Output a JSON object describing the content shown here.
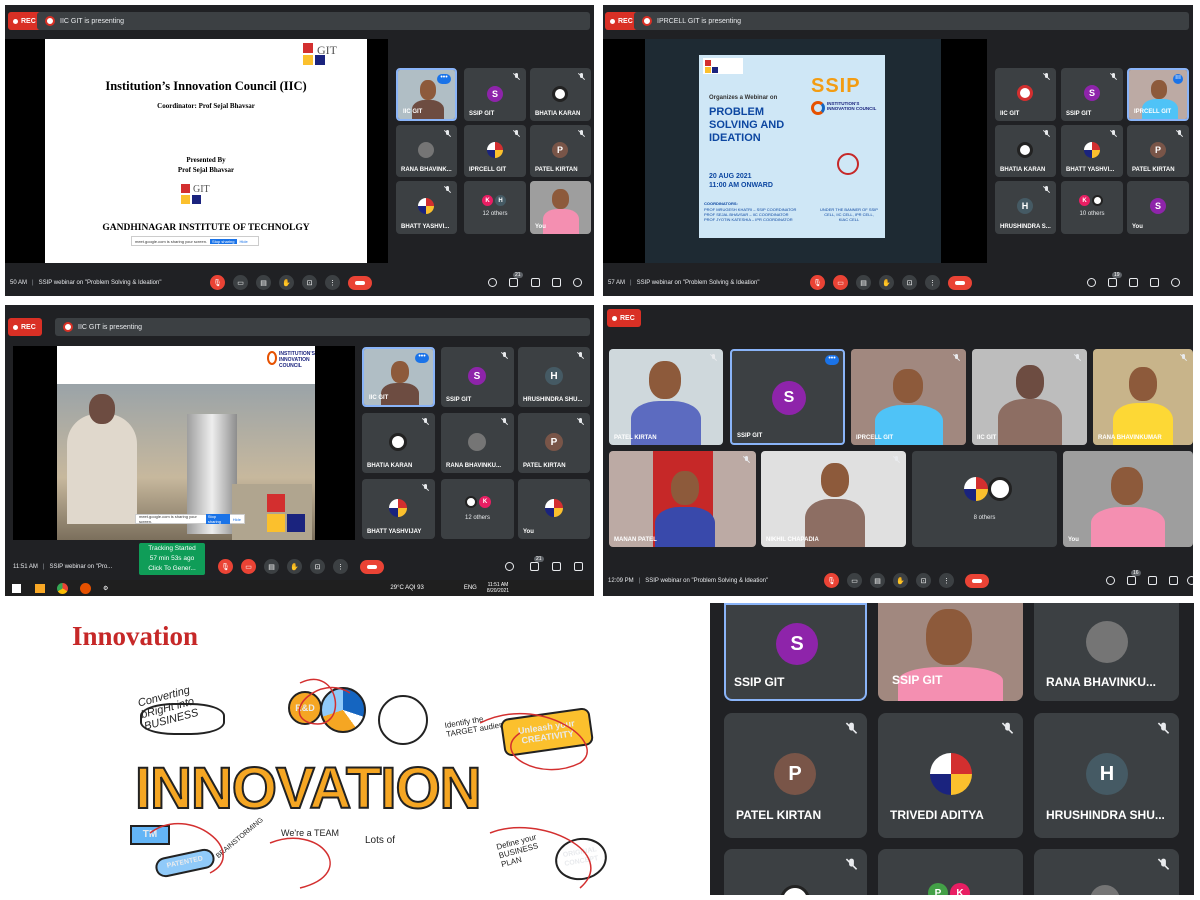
{
  "panel1": {
    "rec": "REC",
    "presenting": "IIC GIT is presenting",
    "slide": {
      "title": "Institution’s Innovation Council (IIC)",
      "coordinator": "Coordinator: Prof Sejal Bhavsar",
      "presented_by": "Presented By",
      "presenter": "Prof Sejal Bhavsar",
      "institute": "GANDHINAGAR INSTITUTE OF TECHNOLGY",
      "share_notice": "meet.google.com is sharing your screen.",
      "stop_sharing": "Stop sharing",
      "hide": "Hide"
    },
    "tiles": [
      {
        "name": "IIC GIT"
      },
      {
        "name": "SSIP GIT",
        "initial": "S",
        "color": "#8e24aa"
      },
      {
        "name": "BHATIA KARAN"
      },
      {
        "name": "RANA BHAVINK..."
      },
      {
        "name": "IPRCELL GIT"
      },
      {
        "name": "PATEL KIRTAN",
        "initial": "P",
        "color": "#795548"
      },
      {
        "name": "BHATT YASHVI..."
      },
      {
        "name": "12 others",
        "chips": [
          "K",
          "H"
        ]
      },
      {
        "name": "You"
      }
    ],
    "bar": {
      "time": "50 AM",
      "title": "SSIP webinar on \"Problem Solving & Ideation\"",
      "people": "21"
    }
  },
  "panel2": {
    "rec": "REC",
    "presenting": "IPRCELL GIT is presenting",
    "poster": {
      "brand": "SSIP",
      "org": "INSTITUTION'S INNOVATION COUNCIL",
      "intro": "Organizes a Webinar on",
      "headline": "PROBLEM SOLVING AND IDEATION",
      "date": "20 AUG 2021",
      "time": "11:00 AM ONWARD",
      "coord_head": "COORDINATORS:",
      "coords": [
        "PROF MRUGESH KHATRI – SSIP COORDINATOR",
        "PROF SEJAL BHAVSAR – IIC COORDINATOR",
        "PROF JYOTIN KATESHIA – IPR COORDINATOR"
      ],
      "banner": "UNDER THE BANNER OF SSIP CELL, IIC CELL, IPR CELL, KIAC CELL"
    },
    "tiles": [
      {
        "name": "IIC GIT"
      },
      {
        "name": "SSIP GIT",
        "initial": "S",
        "color": "#8e24aa"
      },
      {
        "name": "IPRCELL GIT"
      },
      {
        "name": "BHATIA KARAN"
      },
      {
        "name": "BHATT YASHVI..."
      },
      {
        "name": "PATEL KIRTAN",
        "initial": "P",
        "color": "#795548"
      },
      {
        "name": "HRUSHINDRA S...",
        "initial": "H",
        "color": "#455a64"
      },
      {
        "name": "10 others",
        "chips": [
          "K"
        ]
      },
      {
        "name": "You",
        "initial": "S",
        "color": "#8e24aa"
      }
    ],
    "bar": {
      "time": "57 AM",
      "title": "SSIP webinar on \"Problem Solving & Ideation\"",
      "people": "19"
    }
  },
  "panel3": {
    "rec": "REC",
    "presenting": "IIC GIT is presenting",
    "slide": {
      "share_notice": "meet.google.com is sharing your screen.",
      "stop_sharing": "Stop sharing",
      "hide": "Hide"
    },
    "tiles": [
      {
        "name": "IIC GIT"
      },
      {
        "name": "SSIP GIT",
        "initial": "S",
        "color": "#8e24aa"
      },
      {
        "name": "HRUSHINDRA SHU...",
        "initial": "H",
        "color": "#455a64"
      },
      {
        "name": "BHATIA KARAN"
      },
      {
        "name": "RANA BHAVINKU..."
      },
      {
        "name": "PATEL KIRTAN",
        "initial": "P",
        "color": "#795548"
      },
      {
        "name": "BHATT YASHVIJAY"
      },
      {
        "name": "12 others",
        "chips": [
          "K"
        ]
      },
      {
        "name": "You"
      }
    ],
    "bar": {
      "time": "11:51 AM",
      "title": "SSIP webinar on \"Pro...",
      "people": "21"
    },
    "tracker": {
      "line1": "Tracking Started",
      "line2": "57 min 53s ago",
      "line3": "Click To Gener..."
    },
    "taskbar": {
      "weather": "29°C  AQI 93",
      "lang": "ENG",
      "clock": "11:51 AM",
      "date": "8/20/2021"
    }
  },
  "panel4": {
    "rec": "REC",
    "tiles": [
      {
        "name": "PATEL KIRTAN"
      },
      {
        "name": "SSIP GIT",
        "initial": "S",
        "color": "#8e24aa"
      },
      {
        "name": "IPRCELL GIT"
      },
      {
        "name": "IIC GIT"
      },
      {
        "name": "RANA BHAVINKUMAR"
      },
      {
        "name": "MANAN PATEL"
      },
      {
        "name": "NIKHIL CHAPADIA"
      },
      {
        "name": "8 others"
      },
      {
        "name": "You"
      }
    ],
    "bar": {
      "time": "12:09 PM",
      "title": "SSIP webinar on \"Problem Solving & Ideation\"",
      "people": "16"
    }
  },
  "panel5": {
    "title": "Innovation",
    "big_word": "INNOVATION",
    "doodles": [
      "Converting bRigHt into BUSINESS",
      "R&D",
      "Identify the TARGET audience",
      "Unleash your CREATIVITY",
      "TM",
      "PATENTED",
      "BRAINSTORMING",
      "We're a TEAM",
      "Lots of",
      "Define your BUSINESS PLAN",
      "ORIGINAL CONCEPT"
    ]
  },
  "panel6": {
    "tiles": [
      {
        "name": "SSIP GIT",
        "initial": "S",
        "color": "#8e24aa"
      },
      {
        "name": "SSIP GIT"
      },
      {
        "name": "RANA BHAVINKU..."
      },
      {
        "name": "PATEL KIRTAN",
        "initial": "P",
        "color": "#795548"
      },
      {
        "name": "TRIVEDI ADITYA"
      },
      {
        "name": "HRUSHINDRA SHU...",
        "initial": "H",
        "color": "#455a64"
      }
    ],
    "bottom_chips": [
      "P",
      "K"
    ]
  }
}
